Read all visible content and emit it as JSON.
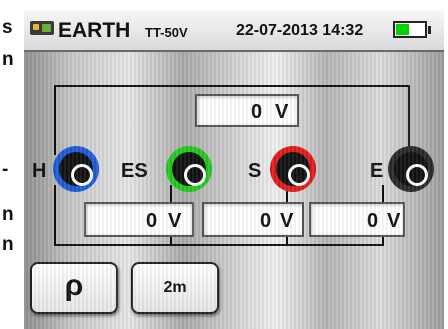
{
  "edge_text": [
    "s",
    "n",
    "-",
    "n",
    "n"
  ],
  "header": {
    "title": "EARTH",
    "subtitle": "TT-50V",
    "datetime": "22-07-2013 14:32",
    "battery_level": 0.45
  },
  "readings": {
    "top": {
      "value": "0",
      "unit": "V"
    },
    "h_es": {
      "value": "0",
      "unit": "V"
    },
    "es_s": {
      "value": "0",
      "unit": "V"
    },
    "s_e": {
      "value": "0",
      "unit": "V"
    }
  },
  "terminals": [
    {
      "label": "H",
      "color": "#1f5bd6"
    },
    {
      "label": "ES",
      "color": "#22c81e"
    },
    {
      "label": "S",
      "color": "#e01b1b"
    },
    {
      "label": "E",
      "color": "#2a2a2a"
    }
  ],
  "softkeys": [
    {
      "label": "ρ"
    },
    {
      "label": "2m"
    }
  ],
  "colors": {
    "battery": "#00d400"
  }
}
